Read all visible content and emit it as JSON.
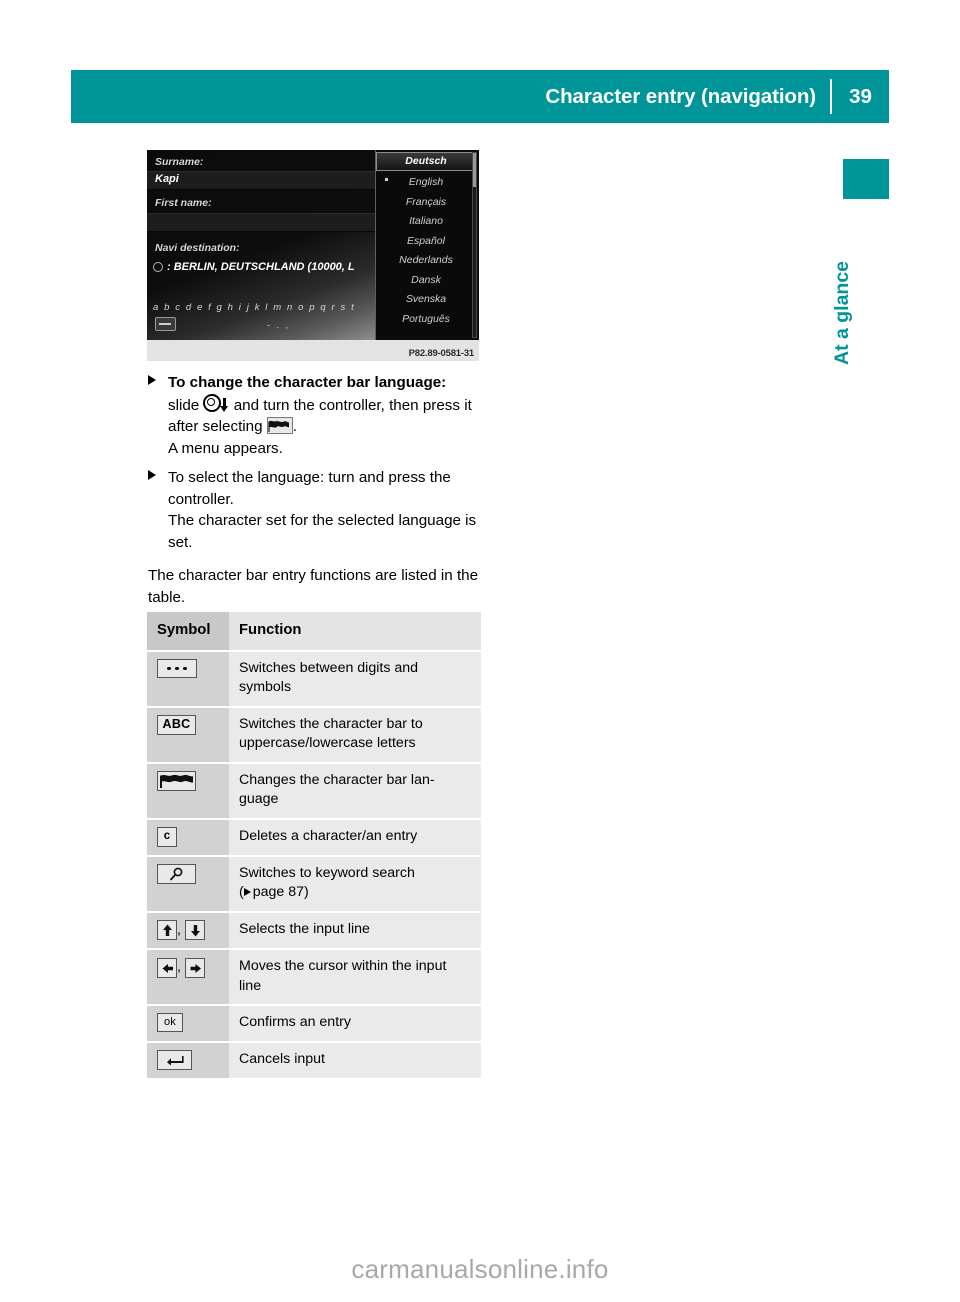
{
  "header": {
    "title": "Character entry (navigation)",
    "page_number": "39",
    "accent_color": "#009699"
  },
  "side_tab": {
    "label": "At a glance"
  },
  "figure": {
    "caption": "P82.89-0581-31",
    "screen": {
      "fields": [
        {
          "label": "Surname:",
          "value": "Kapi"
        },
        {
          "label": "First name:",
          "value": ""
        },
        {
          "label": "Navi destination:",
          "value": ": BERLIN, DEUTSCHLAND (10000, L"
        }
      ],
      "character_bar": "a b c d e f g h i j k l m n o p q r s t",
      "character_bar_row2": "- . ,",
      "language_menu": {
        "selected": "Deutsch",
        "current_marked": "English",
        "items": [
          "Deutsch",
          "English",
          "Français",
          "Italiano",
          "Español",
          "Nederlands",
          "Dansk",
          "Svenska",
          "Português"
        ]
      }
    }
  },
  "body": {
    "steps": [
      {
        "bold_lead": "To change the character bar language:",
        "text_before_controller": "slide",
        "text_after_controller": "and turn the controller, then press it after selecting",
        "text_after_flag": ".",
        "result": "A menu appears."
      },
      {
        "text": "To select the language: turn and press the controller.",
        "result": "The character set for the selected language is set."
      }
    ],
    "paragraph": "The character bar entry functions are listed in the table."
  },
  "table": {
    "headers": {
      "symbol": "Symbol",
      "function": "Function"
    },
    "rows": [
      {
        "icon": "dots-key-icon",
        "symbol_text": "",
        "function": "Switches between digits and symbols"
      },
      {
        "icon": "abc-key-icon",
        "symbol_text": "ABC",
        "function": "Switches the character bar to uppercase/lowercase letters"
      },
      {
        "icon": "flag-key-icon",
        "symbol_text": "",
        "function": "Changes the character bar lan-guage"
      },
      {
        "icon": "delete-key-icon",
        "symbol_text": "c",
        "function": "Deletes a character/an entry"
      },
      {
        "icon": "search-key-icon",
        "symbol_text": "",
        "function": "Switches to keyword search",
        "page_ref": "page 87"
      },
      {
        "icon": "up-down-arrow-icon",
        "symbol_text": ",",
        "function": "Selects the input line"
      },
      {
        "icon": "left-right-arrow-icon",
        "symbol_text": ",",
        "function": "Moves the cursor within the input line"
      },
      {
        "icon": "ok-key-icon",
        "symbol_text": "ok",
        "function": "Confirms an entry"
      },
      {
        "icon": "back-key-icon",
        "symbol_text": "",
        "function": "Cancels input"
      }
    ]
  },
  "watermark": {
    "text": "carmanualsonline.info"
  }
}
